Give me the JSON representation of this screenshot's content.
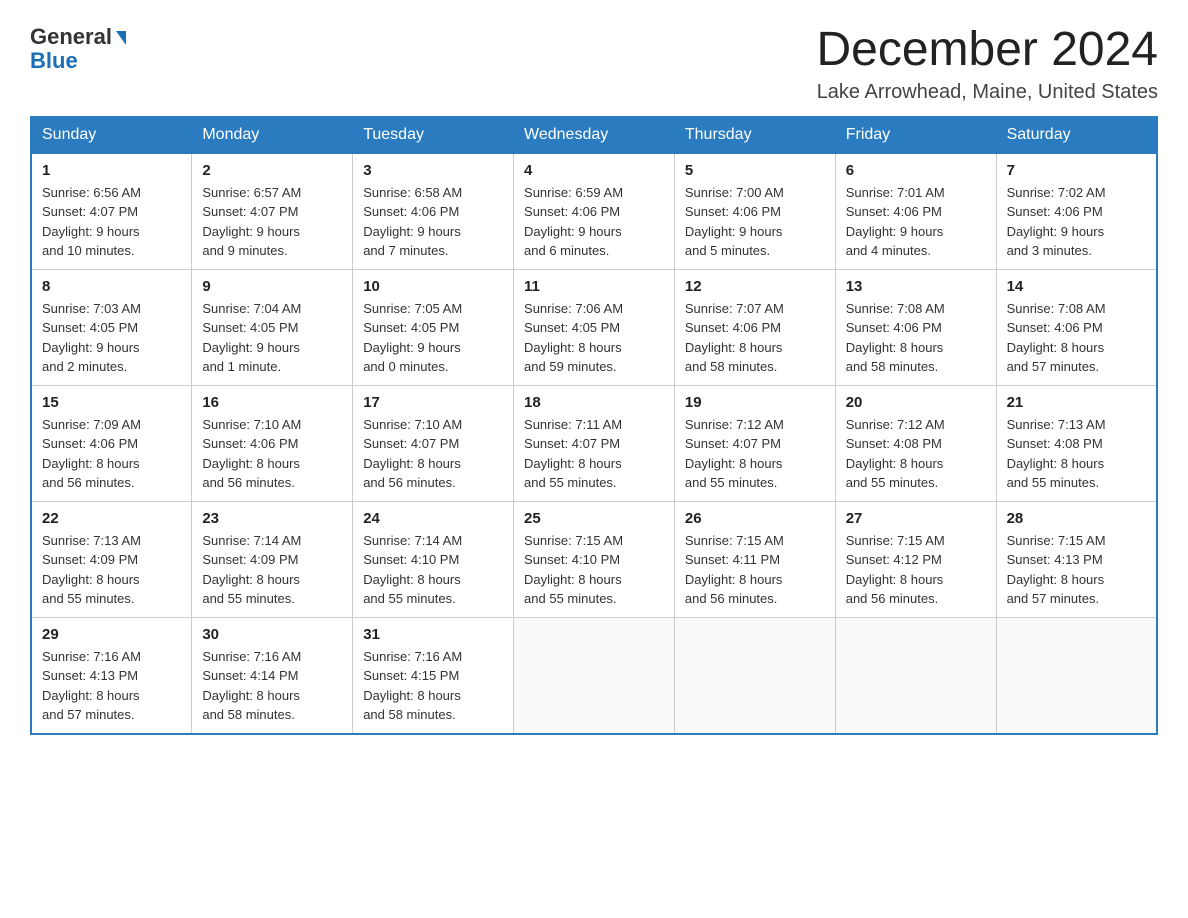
{
  "logo": {
    "general": "General",
    "blue": "Blue"
  },
  "header": {
    "title": "December 2024",
    "subtitle": "Lake Arrowhead, Maine, United States"
  },
  "days_of_week": [
    "Sunday",
    "Monday",
    "Tuesday",
    "Wednesday",
    "Thursday",
    "Friday",
    "Saturday"
  ],
  "weeks": [
    [
      {
        "day": "1",
        "sunrise": "6:56 AM",
        "sunset": "4:07 PM",
        "daylight": "9 hours and 10 minutes."
      },
      {
        "day": "2",
        "sunrise": "6:57 AM",
        "sunset": "4:07 PM",
        "daylight": "9 hours and 9 minutes."
      },
      {
        "day": "3",
        "sunrise": "6:58 AM",
        "sunset": "4:06 PM",
        "daylight": "9 hours and 7 minutes."
      },
      {
        "day": "4",
        "sunrise": "6:59 AM",
        "sunset": "4:06 PM",
        "daylight": "9 hours and 6 minutes."
      },
      {
        "day": "5",
        "sunrise": "7:00 AM",
        "sunset": "4:06 PM",
        "daylight": "9 hours and 5 minutes."
      },
      {
        "day": "6",
        "sunrise": "7:01 AM",
        "sunset": "4:06 PM",
        "daylight": "9 hours and 4 minutes."
      },
      {
        "day": "7",
        "sunrise": "7:02 AM",
        "sunset": "4:06 PM",
        "daylight": "9 hours and 3 minutes."
      }
    ],
    [
      {
        "day": "8",
        "sunrise": "7:03 AM",
        "sunset": "4:05 PM",
        "daylight": "9 hours and 2 minutes."
      },
      {
        "day": "9",
        "sunrise": "7:04 AM",
        "sunset": "4:05 PM",
        "daylight": "9 hours and 1 minute."
      },
      {
        "day": "10",
        "sunrise": "7:05 AM",
        "sunset": "4:05 PM",
        "daylight": "9 hours and 0 minutes."
      },
      {
        "day": "11",
        "sunrise": "7:06 AM",
        "sunset": "4:05 PM",
        "daylight": "8 hours and 59 minutes."
      },
      {
        "day": "12",
        "sunrise": "7:07 AM",
        "sunset": "4:06 PM",
        "daylight": "8 hours and 58 minutes."
      },
      {
        "day": "13",
        "sunrise": "7:08 AM",
        "sunset": "4:06 PM",
        "daylight": "8 hours and 58 minutes."
      },
      {
        "day": "14",
        "sunrise": "7:08 AM",
        "sunset": "4:06 PM",
        "daylight": "8 hours and 57 minutes."
      }
    ],
    [
      {
        "day": "15",
        "sunrise": "7:09 AM",
        "sunset": "4:06 PM",
        "daylight": "8 hours and 56 minutes."
      },
      {
        "day": "16",
        "sunrise": "7:10 AM",
        "sunset": "4:06 PM",
        "daylight": "8 hours and 56 minutes."
      },
      {
        "day": "17",
        "sunrise": "7:10 AM",
        "sunset": "4:07 PM",
        "daylight": "8 hours and 56 minutes."
      },
      {
        "day": "18",
        "sunrise": "7:11 AM",
        "sunset": "4:07 PM",
        "daylight": "8 hours and 55 minutes."
      },
      {
        "day": "19",
        "sunrise": "7:12 AM",
        "sunset": "4:07 PM",
        "daylight": "8 hours and 55 minutes."
      },
      {
        "day": "20",
        "sunrise": "7:12 AM",
        "sunset": "4:08 PM",
        "daylight": "8 hours and 55 minutes."
      },
      {
        "day": "21",
        "sunrise": "7:13 AM",
        "sunset": "4:08 PM",
        "daylight": "8 hours and 55 minutes."
      }
    ],
    [
      {
        "day": "22",
        "sunrise": "7:13 AM",
        "sunset": "4:09 PM",
        "daylight": "8 hours and 55 minutes."
      },
      {
        "day": "23",
        "sunrise": "7:14 AM",
        "sunset": "4:09 PM",
        "daylight": "8 hours and 55 minutes."
      },
      {
        "day": "24",
        "sunrise": "7:14 AM",
        "sunset": "4:10 PM",
        "daylight": "8 hours and 55 minutes."
      },
      {
        "day": "25",
        "sunrise": "7:15 AM",
        "sunset": "4:10 PM",
        "daylight": "8 hours and 55 minutes."
      },
      {
        "day": "26",
        "sunrise": "7:15 AM",
        "sunset": "4:11 PM",
        "daylight": "8 hours and 56 minutes."
      },
      {
        "day": "27",
        "sunrise": "7:15 AM",
        "sunset": "4:12 PM",
        "daylight": "8 hours and 56 minutes."
      },
      {
        "day": "28",
        "sunrise": "7:15 AM",
        "sunset": "4:13 PM",
        "daylight": "8 hours and 57 minutes."
      }
    ],
    [
      {
        "day": "29",
        "sunrise": "7:16 AM",
        "sunset": "4:13 PM",
        "daylight": "8 hours and 57 minutes."
      },
      {
        "day": "30",
        "sunrise": "7:16 AM",
        "sunset": "4:14 PM",
        "daylight": "8 hours and 58 minutes."
      },
      {
        "day": "31",
        "sunrise": "7:16 AM",
        "sunset": "4:15 PM",
        "daylight": "8 hours and 58 minutes."
      },
      null,
      null,
      null,
      null
    ]
  ],
  "labels": {
    "sunrise": "Sunrise:",
    "sunset": "Sunset:",
    "daylight": "Daylight:"
  }
}
